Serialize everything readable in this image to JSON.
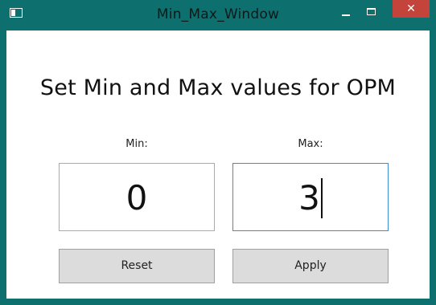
{
  "window": {
    "title": "Min_Max_Window",
    "close_glyph": "✕",
    "title_bar_color": "#0e6f6f",
    "close_button_color": "#c4433b"
  },
  "main": {
    "heading": "Set Min and Max values for OPM",
    "min": {
      "label": "Min:",
      "value": "0"
    },
    "max": {
      "label": "Max:",
      "value": "3",
      "focused": true
    },
    "buttons": {
      "reset": "Reset",
      "apply": "Apply"
    }
  }
}
